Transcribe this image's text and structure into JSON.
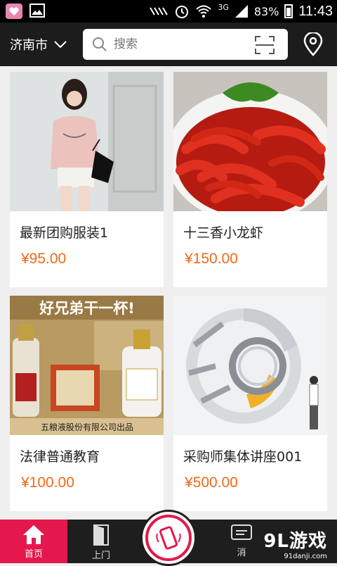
{
  "status": {
    "net": "3G",
    "battery": "83%",
    "time": "11:43"
  },
  "header": {
    "city": "济南市",
    "search_placeholder": "搜索"
  },
  "products": [
    {
      "title": "最新团购服装1",
      "price": "¥95.00",
      "image": "woman-in-pink-tshirt"
    },
    {
      "title": "十三香小龙虾",
      "price": "¥150.00",
      "image": "crayfish-dish"
    },
    {
      "title": "法律普通教育",
      "price": "¥100.00",
      "image": "liquor-bottles-ad",
      "image_text": {
        "banner": "好兄弟干一杯!",
        "footer": "五粮液股份有限公司出品"
      }
    },
    {
      "title": "采购师集体讲座001",
      "price": "¥500.00",
      "image": "chart-ring-businessman"
    }
  ],
  "nav": {
    "home": "首页",
    "visit": "上门",
    "message": "消"
  },
  "watermark": {
    "logo": "9L游戏",
    "site": "91danji.com"
  },
  "colors": {
    "accent": "#e5184d",
    "price": "#ef6a1b",
    "topbar": "#1c1c1c"
  }
}
